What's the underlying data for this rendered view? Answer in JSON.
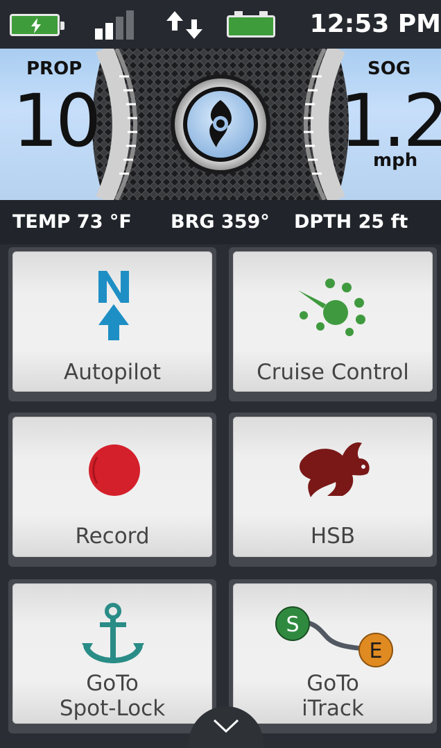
{
  "status": {
    "time": "12:53 PM",
    "phone_battery_icon": "charging-battery-icon",
    "signal_icon": "signal-strength-icon",
    "transfer_icon": "data-transfer-icon",
    "boat_battery_icon": "boat-battery-icon",
    "colors": {
      "battery": "#3f9c3a",
      "bg": "#262a30"
    }
  },
  "gauge": {
    "left_label": "PROP",
    "left_value": "10",
    "right_label": "SOG",
    "right_value": "1.2",
    "right_unit": "mph",
    "center_icon": "propeller-icon"
  },
  "info": {
    "temp": "TEMP 73 °F",
    "bearing": "BRG 359°",
    "depth": "DPTH 25 ft"
  },
  "tiles": [
    {
      "label": "Autopilot",
      "icon": "north-arrow-icon"
    },
    {
      "label": "Cruise Control",
      "icon": "speedometer-icon"
    },
    {
      "label": "Record",
      "icon": "record-dot-icon"
    },
    {
      "label": "HSB",
      "icon": "rabbit-icon"
    },
    {
      "label_line1": "GoTo",
      "label_line2": "Spot-Lock",
      "icon": "anchor-icon"
    },
    {
      "label_line1": "GoTo",
      "label_line2": "iTrack",
      "icon": "track-path-icon",
      "start_marker": "S",
      "end_marker": "E"
    }
  ],
  "footer": {
    "expand_icon": "chevron-down-icon"
  }
}
